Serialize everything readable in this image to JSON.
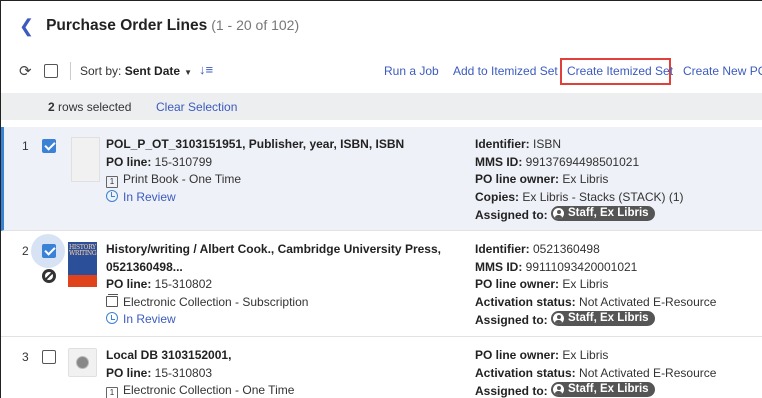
{
  "header": {
    "back_icon": "chevron-left-icon",
    "title": "Purchase Order Lines",
    "count": "(1 - 20 of 102)"
  },
  "toolbar": {
    "sort_label": "Sort by:",
    "sort_value": "Sent Date",
    "actions": {
      "run_job": "Run a Job",
      "add_itemized": "Add to Itemized Set",
      "create_itemized": "Create Itemized Set",
      "create_po": "Create New PO"
    },
    "highlight_color": "#e0403a"
  },
  "selection": {
    "count_bold": "2",
    "count_text": " rows selected",
    "clear": "Clear Selection"
  },
  "rows": [
    {
      "num": "1",
      "checked": true,
      "title": "POL_P_OT_3103151951, Publisher, year, ISBN, ISBN",
      "po_line_label": "PO line:",
      "po_line": " 15-310799",
      "type_badge": "1",
      "type": "Print Book - One Time",
      "status": "In Review",
      "identifier_label": "Identifier:",
      "identifier": " ISBN",
      "mms_label": "MMS ID:",
      "mms": " 99137694498501021",
      "owner_label": "PO line owner:",
      "owner": " Ex Libris",
      "copies_label": "Copies:",
      "copies": " Ex Libris - Stacks (STACK) (1)",
      "assigned_label": "Assigned to:",
      "assigned": "Staff, Ex Libris"
    },
    {
      "num": "2",
      "checked": true,
      "title_line1": "History/writing / Albert Cook., Cambridge University Press,",
      "title_line2": "0521360498...",
      "po_line_label": "PO line:",
      "po_line": " 15-310802",
      "type": "Electronic Collection - Subscription",
      "status": "In Review",
      "cover_text": "HISTORY WRITING",
      "identifier_label": "Identifier:",
      "identifier": " 0521360498",
      "mms_label": "MMS ID:",
      "mms": " 99111093420001021",
      "owner_label": "PO line owner:",
      "owner": " Ex Libris",
      "activation_label": "Activation status:",
      "activation": " Not Activated E-Resource",
      "assigned_label": "Assigned to:",
      "assigned": "Staff, Ex Libris"
    },
    {
      "num": "3",
      "checked": false,
      "title": "Local DB 3103152001,",
      "po_line_label": "PO line:",
      "po_line": " 15-310803",
      "type_badge": "1",
      "type": "Electronic Collection - One Time",
      "owner_label": "PO line owner:",
      "owner": " Ex Libris",
      "activation_label": "Activation status:",
      "activation": " Not Activated E-Resource",
      "assigned_label": "Assigned to:",
      "assigned": "Staff, Ex Libris"
    }
  ]
}
